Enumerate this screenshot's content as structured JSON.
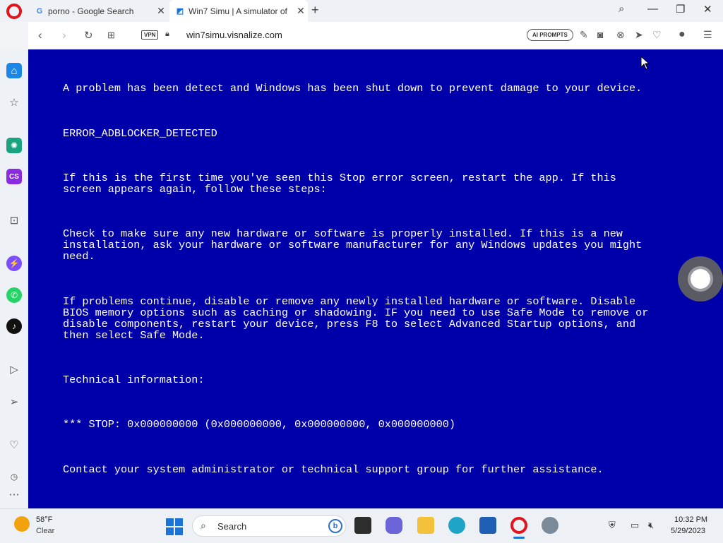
{
  "tabs": [
    {
      "title": "porno - Google Search",
      "icon": "G"
    },
    {
      "title": "Win7 Simu | A simulator of",
      "icon": "◩"
    }
  ],
  "address": {
    "vpn": "VPN",
    "url": "win7simu.visnalize.com",
    "ai_prompts": "AI PROMPTS"
  },
  "bsod": {
    "line1": "A problem has been detect and Windows has been shut down to prevent damage to your device.",
    "error_code": "ERROR_ADBLOCKER_DETECTED",
    "para1": "If this is the first time you've seen this Stop error screen, restart the app. If this\nscreen appears again, follow these steps:",
    "para2": "Check to make sure any new hardware or software is properly installed. If this is a new\ninstallation, ask your hardware or software manufacturer for any Windows updates you might\nneed.",
    "para3": "If problems continue, disable or remove any newly installed hardware or software. Disable\nBIOS memory options such as caching or shadowing. IF you need to use Safe Mode to remove or\ndisable components, restart your device, press F8 to select Advanced Startup options, and\nthen select Safe Mode.",
    "tech_header": "Technical information:",
    "stop_line": "*** STOP: 0x000000000 (0x000000000, 0x000000000, 0x000000000)",
    "contact": "Contact your system administrator or technical support group for further assistance.",
    "bg_color": "#0000aa"
  },
  "taskbar": {
    "temperature": "58°F",
    "condition": "Clear",
    "search_label": "Search",
    "time": "10:32 PM",
    "date": "5/29/2023"
  }
}
